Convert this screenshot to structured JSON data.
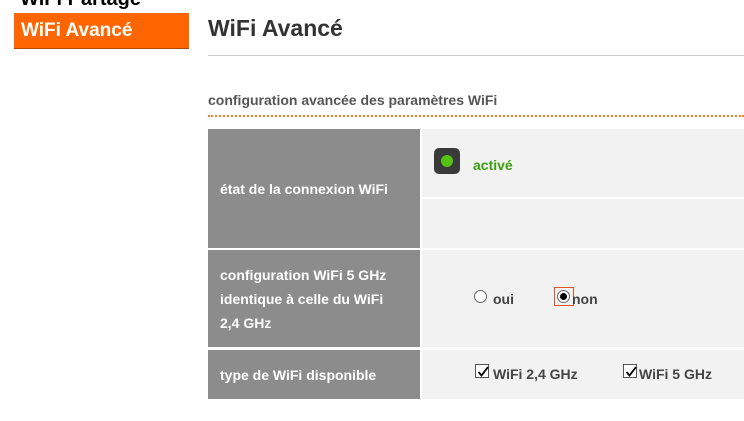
{
  "sidebar": {
    "partial_item_label": "WiFi Partage",
    "active_item_label": "WiFi Avancé"
  },
  "page": {
    "title": "WiFi Avancé",
    "section_title": "configuration avancée des paramètres WiFi"
  },
  "rows": {
    "status": {
      "label": "état de la connexion WiFi",
      "value": "activé",
      "indicator_color": "#55c310"
    },
    "same_config": {
      "label_lines": [
        "configuration WiFi 5 GHz",
        "identique à celle du WiFi",
        "2,4 GHz"
      ],
      "options": [
        {
          "label": "oui",
          "checked": false
        },
        {
          "label": "non",
          "checked": true
        }
      ]
    },
    "wifi_type": {
      "label": "type de WiFi disponible",
      "options": [
        {
          "label": "WiFi 2,4 GHz",
          "checked": true
        },
        {
          "label": "WiFi 5 GHz",
          "checked": true
        }
      ]
    }
  },
  "colors": {
    "accent": "#ff6600",
    "label_cell": "#8c8c8c",
    "value_cell": "#f2f2f2",
    "status_text": "#3ca010"
  }
}
